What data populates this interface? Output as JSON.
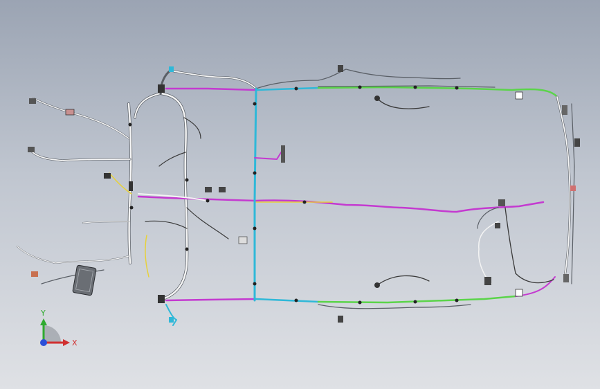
{
  "viewport": {
    "background_top": "#9ba4b3",
    "background_bottom": "#dfe1e5"
  },
  "harness": {
    "wire_colors": {
      "white": "#f4f4f4",
      "gray": "#5a5f66",
      "magenta": "#c43ad0",
      "cyan": "#2fb8d8",
      "green": "#5bd44a",
      "yellow": "#e7d13b",
      "dark": "#3a3a3a"
    }
  },
  "triad": {
    "y_label": "Y",
    "x_label": "X",
    "y_color": "#2faa2f",
    "x_color": "#d03030",
    "z_color": "#2a4fd8"
  }
}
